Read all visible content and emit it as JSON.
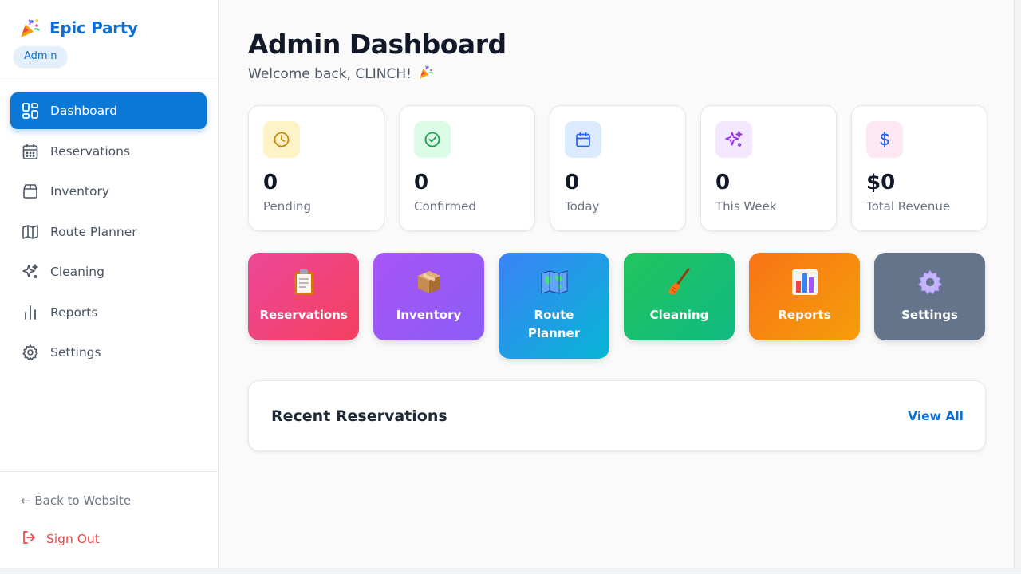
{
  "brand": {
    "name": "Epic Party",
    "role": "Admin"
  },
  "sidebar": {
    "items": [
      {
        "label": "Dashboard",
        "icon": "dashboard-grid-icon",
        "active": true
      },
      {
        "label": "Reservations",
        "icon": "calendar-icon",
        "active": false
      },
      {
        "label": "Inventory",
        "icon": "box-icon",
        "active": false
      },
      {
        "label": "Route Planner",
        "icon": "map-icon",
        "active": false
      },
      {
        "label": "Cleaning",
        "icon": "sparkles-icon",
        "active": false
      },
      {
        "label": "Reports",
        "icon": "bar-chart-icon",
        "active": false
      },
      {
        "label": "Settings",
        "icon": "gear-icon",
        "active": false
      }
    ],
    "back_link": "← Back to Website",
    "sign_out": "Sign Out"
  },
  "header": {
    "title": "Admin Dashboard",
    "subtitle": "Welcome back, CLINCH!"
  },
  "stats": [
    {
      "value": "0",
      "label": "Pending",
      "icon": "clock-icon",
      "color": "#ca8a04",
      "bg": "#fef3c7"
    },
    {
      "value": "0",
      "label": "Confirmed",
      "icon": "check-circle-icon",
      "color": "#16a34a",
      "bg": "#dcfce7"
    },
    {
      "value": "0",
      "label": "Today",
      "icon": "calendar-icon",
      "color": "#2563eb",
      "bg": "#dbeafe"
    },
    {
      "value": "0",
      "label": "This Week",
      "icon": "sparkles-icon",
      "color": "#9333ea",
      "bg": "#f3e8ff"
    },
    {
      "value": "$0",
      "label": "Total Revenue",
      "icon": "dollar-icon",
      "color": "#2563eb",
      "bg": "#fce7f3"
    }
  ],
  "tiles": [
    {
      "label": "Reservations",
      "icon": "clipboard-icon",
      "gradient": [
        "#ec4899",
        "#f43f5e"
      ]
    },
    {
      "label": "Inventory",
      "icon": "package-icon",
      "gradient": [
        "#a855f7",
        "#8b5cf6"
      ]
    },
    {
      "label": "Route Planner",
      "icon": "world-map-icon",
      "gradient": [
        "#3b82f6",
        "#06b6d4"
      ]
    },
    {
      "label": "Cleaning",
      "icon": "broom-icon",
      "gradient": [
        "#22c55e",
        "#10b981"
      ]
    },
    {
      "label": "Reports",
      "icon": "bar-chart-icon",
      "gradient": [
        "#f97316",
        "#f59e0b"
      ]
    },
    {
      "label": "Settings",
      "icon": "gear-icon",
      "gradient": [
        "#64748b",
        "#64748b"
      ]
    }
  ],
  "recent": {
    "title": "Recent Reservations",
    "view_all": "View All"
  },
  "colors": {
    "accent": "#0b78d8",
    "danger": "#ef4444"
  }
}
